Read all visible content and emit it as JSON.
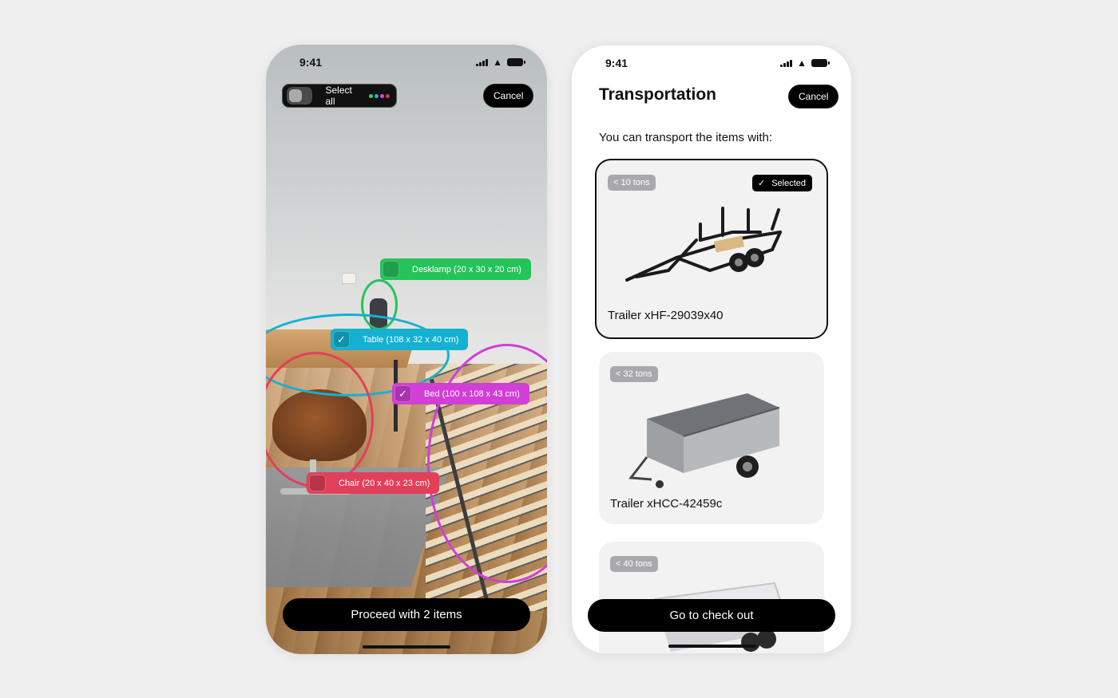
{
  "left_screen": {
    "status_time": "9:41",
    "select_all": {
      "label": "Select all",
      "dot_colors": [
        "#2fd36b",
        "#1cb4d8",
        "#e23ee0",
        "#e5304e"
      ]
    },
    "cancel_label": "Cancel",
    "detections": [
      {
        "label": "Desklamp (20 x 30 x 20 cm)",
        "color": "#25c35a",
        "checked": false
      },
      {
        "label": "Table (108 x 32 x 40 cm)",
        "color": "#14b1d2",
        "checked": true
      },
      {
        "label": "Bed (100 x 108 x 43 cm)",
        "color": "#d13fd6",
        "checked": true
      },
      {
        "label": "Chair (20 x 40 x 23 cm)",
        "color": "#e2405a",
        "checked": false
      }
    ],
    "proceed_label": "Proceed with 2 items"
  },
  "right_screen": {
    "status_time": "9:41",
    "title": "Transportation",
    "cancel_label": "Cancel",
    "subtitle": "You can transport the items with:",
    "cards": [
      {
        "capacity": "< 10 tons",
        "name": "Trailer xHF-29039x40",
        "selected": true,
        "selected_label": "Selected"
      },
      {
        "capacity": "< 32 tons",
        "name": "Trailer xHCC-42459c",
        "selected": false
      },
      {
        "capacity": "< 40 tons",
        "name": "",
        "selected": false
      }
    ],
    "checkout_label": "Go to check out"
  }
}
